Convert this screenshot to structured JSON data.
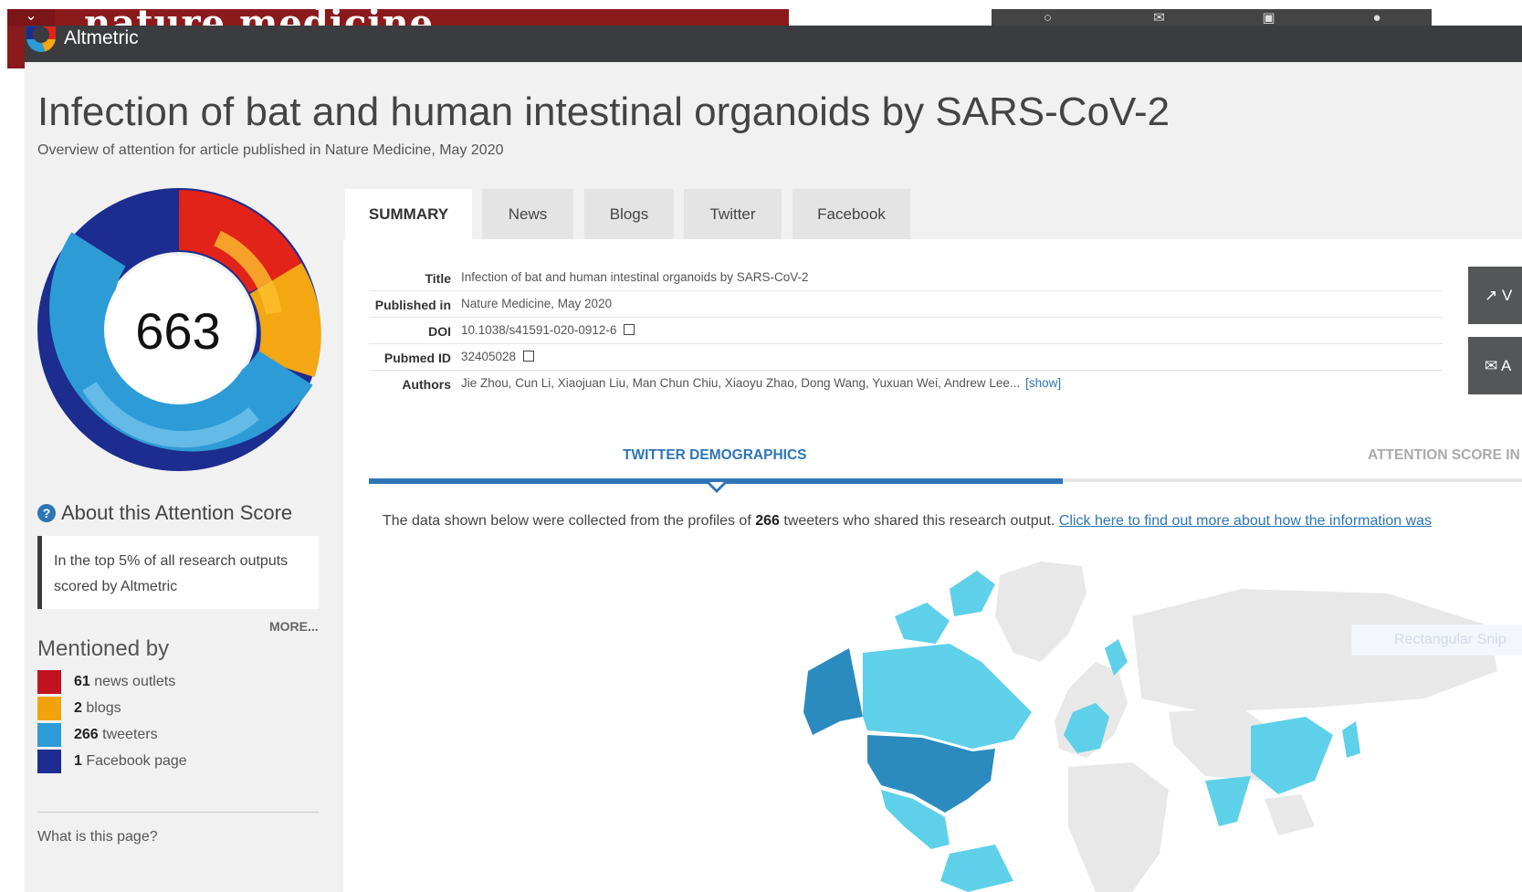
{
  "background_site": {
    "logo": "nature medicine",
    "menu_icon": "chevron-down-icon",
    "header_icons": [
      "search-icon",
      "mail-icon",
      "download-icon",
      "user-icon"
    ]
  },
  "altmetric": {
    "brand": "Altmetric"
  },
  "article": {
    "title": "Infection of bat and human intestinal organoids by SARS-CoV-2",
    "subtitle": "Overview of attention for article published in Nature Medicine, May 2020"
  },
  "score": {
    "value": "663",
    "donut_colors": [
      "#1c2d8f",
      "#e2231a",
      "#f3a712",
      "#2d9cd6"
    ]
  },
  "about": {
    "heading": "About this Attention Score",
    "text": "In the top 5% of all research outputs scored by Altmetric",
    "more": "MORE..."
  },
  "mentioned_by": {
    "heading": "Mentioned by",
    "items": [
      {
        "count": "61",
        "label": "news outlets",
        "color": "#c1121f"
      },
      {
        "count": "2",
        "label": "blogs",
        "color": "#f0a30a"
      },
      {
        "count": "266",
        "label": "tweeters",
        "color": "#2d9cd6"
      },
      {
        "count": "1",
        "label": "Facebook page",
        "color": "#1c2d8f"
      }
    ]
  },
  "what_is_this": "What is this page?",
  "tabs": [
    "SUMMARY",
    "News",
    "Blogs",
    "Twitter",
    "Facebook"
  ],
  "summary": {
    "title_label": "Title",
    "title_value": "Infection of bat and human intestinal organoids by SARS-CoV-2",
    "published_label": "Published in",
    "published_value": "Nature Medicine, May 2020",
    "doi_label": "DOI",
    "doi_value": "10.1038/s41591-020-0912-6",
    "pubmed_label": "Pubmed ID",
    "pubmed_value": "32405028",
    "authors_label": "Authors",
    "authors_value": "Jie Zhou, Cun Li, Xiaojuan Liu, Man Chun Chiu, Xiaoyu Zhao, Dong Wang, Yuxuan Wei, Andrew Lee...",
    "authors_show": "[show]"
  },
  "side_buttons": [
    {
      "icon": "external-link-icon",
      "label": "V"
    },
    {
      "icon": "mail-icon",
      "label": "A"
    }
  ],
  "demographics": {
    "tab_active": "TWITTER DEMOGRAPHICS",
    "tab_other": "ATTENTION SCORE IN",
    "note_before": "The data shown below were collected from the profiles of ",
    "note_count": "266",
    "note_after": " tweeters who shared this research output. ",
    "note_link": "Click here to find out more about how the information was",
    "map_tooltip": "Rectangular Snip"
  }
}
